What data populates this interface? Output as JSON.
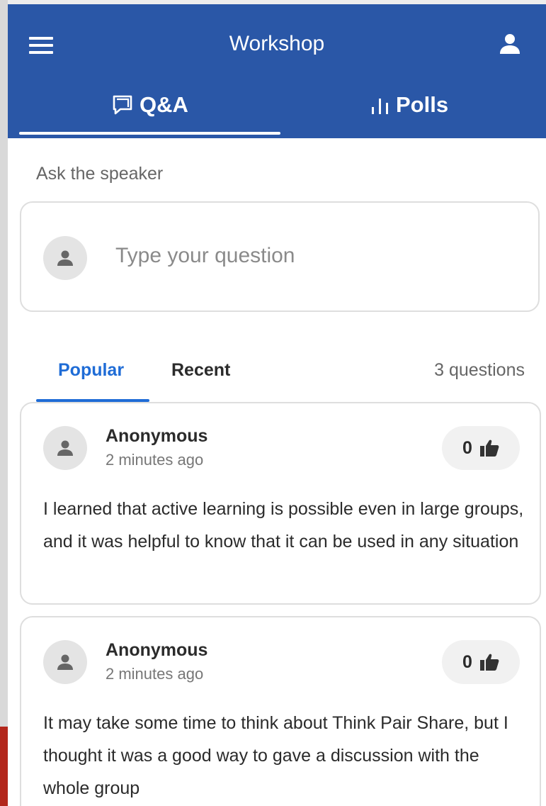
{
  "header": {
    "title": "Workshop",
    "menu_icon": "hamburger-menu-icon",
    "profile_icon": "person-icon"
  },
  "tabs": [
    {
      "label": "Q&A",
      "icon": "chat-bubble-icon",
      "active": true
    },
    {
      "label": "Polls",
      "icon": "bar-chart-icon",
      "active": false
    }
  ],
  "ask": {
    "label": "Ask the speaker",
    "placeholder": "Type your question"
  },
  "sort": {
    "popular_label": "Popular",
    "recent_label": "Recent",
    "active": "Popular",
    "count_text": "3 questions"
  },
  "questions": [
    {
      "author": "Anonymous",
      "time": "2 minutes ago",
      "likes": "0",
      "text": "I learned that active learning is possible even in large groups, and it was helpful to know that it can be used in any situation"
    },
    {
      "author": "Anonymous",
      "time": "2 minutes ago",
      "likes": "0",
      "text": "It may take some time to think about Think Pair Share, but I thought it was a good way to gave a discussion with the whole group"
    }
  ],
  "colors": {
    "header_bg": "#2a57a7",
    "accent": "#1f6cd6"
  }
}
